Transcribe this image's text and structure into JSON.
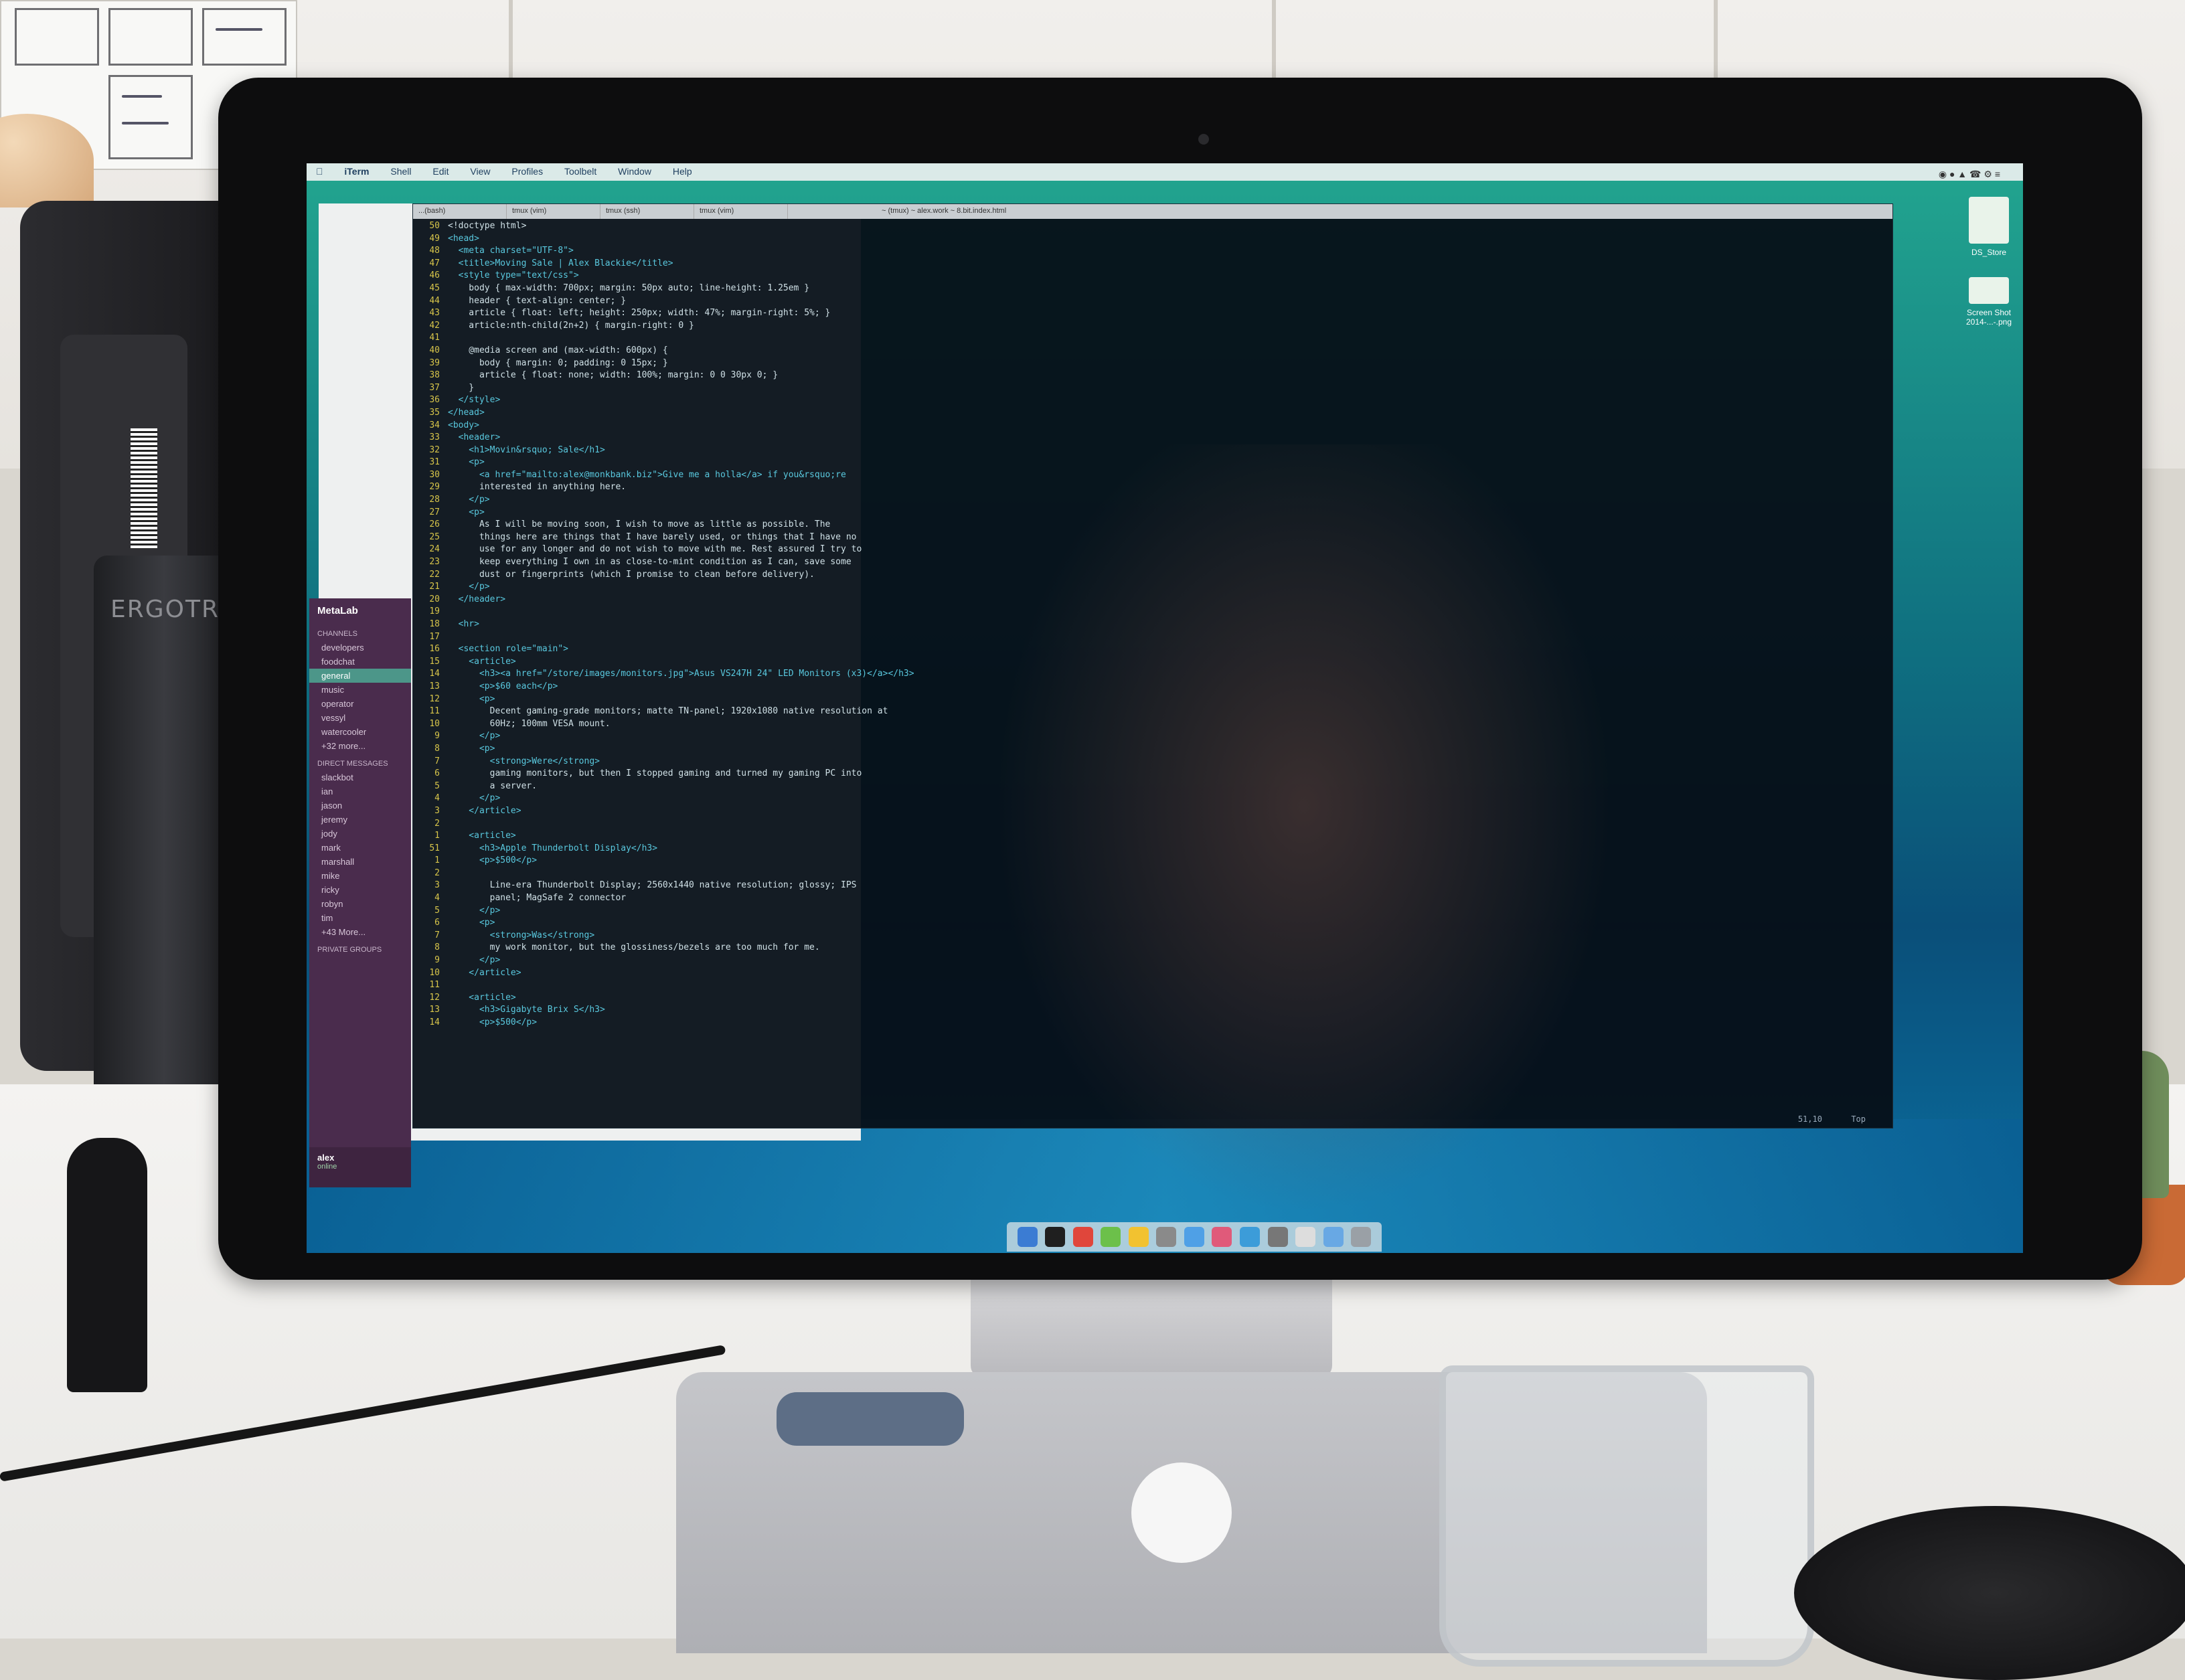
{
  "scene": {
    "ergotron_label": "ERGOTRON"
  },
  "menubar": {
    "app": "iTerm",
    "items": [
      "Shell",
      "Edit",
      "View",
      "Profiles",
      "Toolbelt",
      "Window",
      "Help"
    ]
  },
  "desktop": {
    "icons": [
      {
        "label": "DS_Store",
        "icon": "file-icon"
      },
      {
        "label": "Screen Shot 2014-...-.png",
        "icon": "image-file-icon"
      }
    ]
  },
  "slack": {
    "team": "MetaLab",
    "channels_heading": "CHANNELS",
    "channels": [
      "developers",
      "foodchat",
      "general",
      "music",
      "operator",
      "vessyl",
      "watercooler",
      "+32 more..."
    ],
    "active_channel": "general",
    "dm_heading": "DIRECT MESSAGES",
    "dms": [
      "slackbot",
      "ian",
      "jason",
      "jeremy",
      "jody",
      "mark",
      "marshall",
      "mike",
      "ricky",
      "robyn",
      "tim",
      "+43 More..."
    ],
    "private_heading": "PRIVATE GROUPS",
    "user": {
      "name": "alex",
      "status": "online"
    }
  },
  "terminal": {
    "tabs": [
      "...(bash)",
      "tmux (vim)",
      "tmux (ssh)",
      "tmux (vim)"
    ],
    "title": "~ (tmux) ~ alex.work ~ 8.bit.index.html",
    "lines": [
      {
        "n": "50",
        "text": "<!doctype html>"
      },
      {
        "n": "49",
        "text": "<head>"
      },
      {
        "n": "48",
        "text": "  <meta charset=\"UTF-8\">"
      },
      {
        "n": "47",
        "text": "  <title>Moving Sale | Alex Blackie</title>"
      },
      {
        "n": "46",
        "text": "  <style type=\"text/css\">"
      },
      {
        "n": "45",
        "text": "    body { max-width: 700px; margin: 50px auto; line-height: 1.25em }"
      },
      {
        "n": "44",
        "text": "    header { text-align: center; }"
      },
      {
        "n": "43",
        "text": "    article { float: left; height: 250px; width: 47%; margin-right: 5%; }"
      },
      {
        "n": "42",
        "text": "    article:nth-child(2n+2) { margin-right: 0 }"
      },
      {
        "n": "41",
        "text": ""
      },
      {
        "n": "40",
        "text": "    @media screen and (max-width: 600px) {"
      },
      {
        "n": "39",
        "text": "      body { margin: 0; padding: 0 15px; }"
      },
      {
        "n": "38",
        "text": "      article { float: none; width: 100%; margin: 0 0 30px 0; }"
      },
      {
        "n": "37",
        "text": "    }"
      },
      {
        "n": "36",
        "text": "  </style>"
      },
      {
        "n": "35",
        "text": "</head>"
      },
      {
        "n": "34",
        "text": "<body>"
      },
      {
        "n": "33",
        "text": "  <header>"
      },
      {
        "n": "32",
        "text": "    <h1>Movin&rsquo; Sale</h1>"
      },
      {
        "n": "31",
        "text": "    <p>"
      },
      {
        "n": "30",
        "text": "      <a href=\"mailto:alex@monkbank.biz\">Give me a holla</a> if you&rsquo;re"
      },
      {
        "n": "29",
        "text": "      interested in anything here."
      },
      {
        "n": "28",
        "text": "    </p>"
      },
      {
        "n": "27",
        "text": "    <p>"
      },
      {
        "n": "26",
        "text": "      As I will be moving soon, I wish to move as little as possible. The"
      },
      {
        "n": "25",
        "text": "      things here are things that I have barely used, or things that I have no"
      },
      {
        "n": "24",
        "text": "      use for any longer and do not wish to move with me. Rest assured I try to"
      },
      {
        "n": "23",
        "text": "      keep everything I own in as close-to-mint condition as I can, save some"
      },
      {
        "n": "22",
        "text": "      dust or fingerprints (which I promise to clean before delivery)."
      },
      {
        "n": "21",
        "text": "    </p>"
      },
      {
        "n": "20",
        "text": "  </header>"
      },
      {
        "n": "19",
        "text": ""
      },
      {
        "n": "18",
        "text": "  <hr>"
      },
      {
        "n": "17",
        "text": ""
      },
      {
        "n": "16",
        "text": "  <section role=\"main\">"
      },
      {
        "n": "15",
        "text": "    <article>"
      },
      {
        "n": "14",
        "text": "      <h3><a href=\"/store/images/monitors.jpg\">Asus VS247H 24\" LED Monitors (x3)</a></h3>"
      },
      {
        "n": "13",
        "text": "      <p>$60 each</p>"
      },
      {
        "n": "12",
        "text": "      <p>"
      },
      {
        "n": "11",
        "text": "        Decent gaming-grade monitors; matte TN-panel; 1920x1080 native resolution at"
      },
      {
        "n": "10",
        "text": "        60Hz; 100mm VESA mount."
      },
      {
        "n": "9",
        "text": "      </p>"
      },
      {
        "n": "8",
        "text": "      <p>"
      },
      {
        "n": "7",
        "text": "        <strong>Were</strong>"
      },
      {
        "n": "6",
        "text": "        gaming monitors, but then I stopped gaming and turned my gaming PC into"
      },
      {
        "n": "5",
        "text": "        a server."
      },
      {
        "n": "4",
        "text": "      </p>"
      },
      {
        "n": "3",
        "text": "    </article>"
      },
      {
        "n": "2",
        "text": ""
      },
      {
        "n": "1",
        "text": "    <article>"
      },
      {
        "n": "51",
        "text": "      <h3>Apple Thunderbolt Display</h3>"
      },
      {
        "n": "1",
        "text": "      <p>$500</p>"
      },
      {
        "n": "2",
        "text": ""
      },
      {
        "n": "3",
        "text": "        Line-era Thunderbolt Display; 2560x1440 native resolution; glossy; IPS"
      },
      {
        "n": "4",
        "text": "        panel; MagSafe 2 connector"
      },
      {
        "n": "5",
        "text": "      </p>"
      },
      {
        "n": "6",
        "text": "      <p>"
      },
      {
        "n": "7",
        "text": "        <strong>Was</strong>"
      },
      {
        "n": "8",
        "text": "        my work monitor, but the glossiness/bezels are too much for me."
      },
      {
        "n": "9",
        "text": "      </p>"
      },
      {
        "n": "10",
        "text": "    </article>"
      },
      {
        "n": "11",
        "text": ""
      },
      {
        "n": "12",
        "text": "    <article>"
      },
      {
        "n": "13",
        "text": "      <h3>Gigabyte Brix S</h3>"
      },
      {
        "n": "14",
        "text": "      <p>$500</p>"
      }
    ],
    "status_position": "51,10",
    "status_scroll": "Top"
  },
  "dock": {
    "icons": [
      "finder-icon",
      "terminal-icon",
      "chrome-icon",
      "app-icon",
      "app-icon",
      "app-icon",
      "app-icon",
      "app-icon",
      "app-icon",
      "app-icon",
      "app-icon",
      "folder-icon",
      "trash-icon"
    ],
    "colors": [
      "#3b7cd3",
      "#1f1f1f",
      "#e0463b",
      "#6cc04a",
      "#f2c230",
      "#8a8a8a",
      "#4fa0e6",
      "#e05a7a",
      "#3c9cd9",
      "#777777",
      "#dddddd",
      "#68a8e4",
      "#9aa0a6"
    ]
  }
}
